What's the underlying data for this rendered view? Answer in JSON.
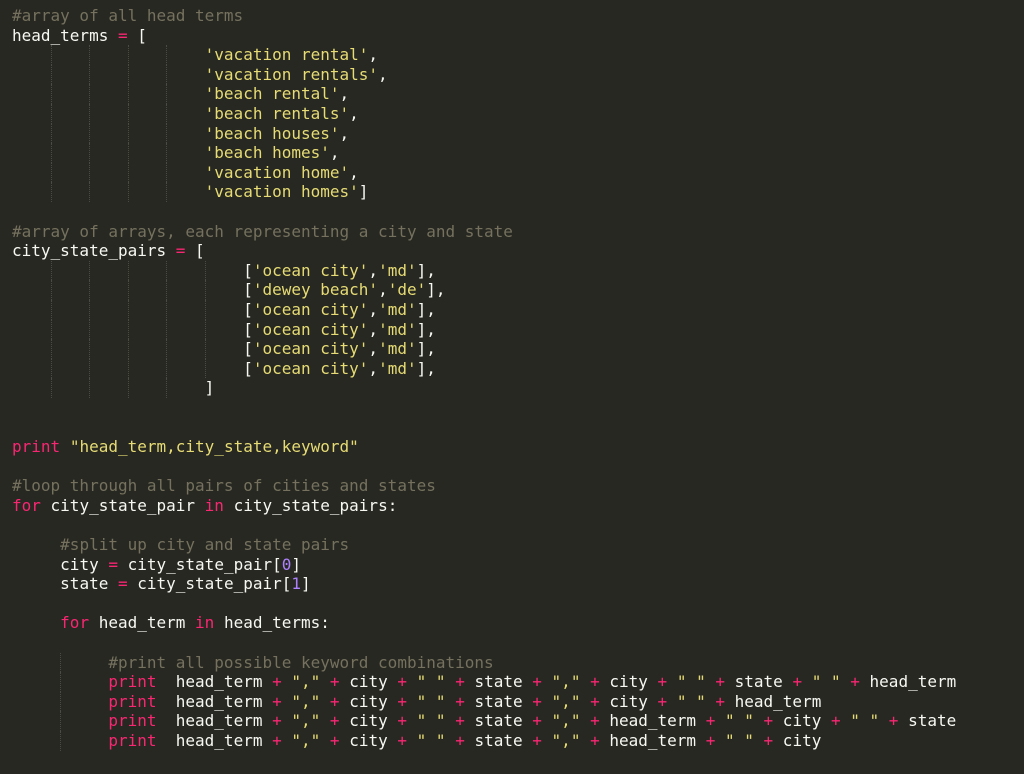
{
  "colors": {
    "background": "#272822",
    "foreground": "#f8f8f2",
    "comment": "#75715e",
    "keyword": "#f92672",
    "string": "#e6db74",
    "number": "#ae81ff"
  },
  "code_lines": [
    {
      "indent": 0,
      "guides": [],
      "tokens": [
        {
          "t": "comment",
          "v": "#array of all head terms"
        }
      ]
    },
    {
      "indent": 0,
      "guides": [],
      "tokens": [
        {
          "t": "ident",
          "v": "head_terms"
        },
        {
          "t": "punc",
          "v": " "
        },
        {
          "t": "op",
          "v": "="
        },
        {
          "t": "punc",
          "v": " ["
        }
      ]
    },
    {
      "indent": 20,
      "guides": [
        4,
        8,
        12,
        16
      ],
      "tokens": [
        {
          "t": "str",
          "v": "'vacation rental'"
        },
        {
          "t": "punc",
          "v": ","
        }
      ]
    },
    {
      "indent": 20,
      "guides": [
        4,
        8,
        12,
        16
      ],
      "tokens": [
        {
          "t": "str",
          "v": "'vacation rentals'"
        },
        {
          "t": "punc",
          "v": ","
        }
      ]
    },
    {
      "indent": 20,
      "guides": [
        4,
        8,
        12,
        16
      ],
      "tokens": [
        {
          "t": "str",
          "v": "'beach rental'"
        },
        {
          "t": "punc",
          "v": ","
        }
      ]
    },
    {
      "indent": 20,
      "guides": [
        4,
        8,
        12,
        16
      ],
      "tokens": [
        {
          "t": "str",
          "v": "'beach rentals'"
        },
        {
          "t": "punc",
          "v": ","
        }
      ]
    },
    {
      "indent": 20,
      "guides": [
        4,
        8,
        12,
        16
      ],
      "tokens": [
        {
          "t": "str",
          "v": "'beach houses'"
        },
        {
          "t": "punc",
          "v": ","
        }
      ]
    },
    {
      "indent": 20,
      "guides": [
        4,
        8,
        12,
        16
      ],
      "tokens": [
        {
          "t": "str",
          "v": "'beach homes'"
        },
        {
          "t": "punc",
          "v": ","
        }
      ]
    },
    {
      "indent": 20,
      "guides": [
        4,
        8,
        12,
        16
      ],
      "tokens": [
        {
          "t": "str",
          "v": "'vacation home'"
        },
        {
          "t": "punc",
          "v": ","
        }
      ]
    },
    {
      "indent": 20,
      "guides": [
        4,
        8,
        12,
        16
      ],
      "tokens": [
        {
          "t": "str",
          "v": "'vacation homes'"
        },
        {
          "t": "punc",
          "v": "]"
        }
      ]
    },
    {
      "indent": 0,
      "guides": [],
      "tokens": []
    },
    {
      "indent": 0,
      "guides": [],
      "tokens": [
        {
          "t": "comment",
          "v": "#array of arrays, each representing a city and state"
        }
      ]
    },
    {
      "indent": 0,
      "guides": [],
      "tokens": [
        {
          "t": "ident",
          "v": "city_state_pairs"
        },
        {
          "t": "punc",
          "v": " "
        },
        {
          "t": "op",
          "v": "="
        },
        {
          "t": "punc",
          "v": " ["
        }
      ]
    },
    {
      "indent": 24,
      "guides": [
        4,
        8,
        12,
        16,
        20
      ],
      "tokens": [
        {
          "t": "punc",
          "v": "["
        },
        {
          "t": "str",
          "v": "'ocean city'"
        },
        {
          "t": "punc",
          "v": ","
        },
        {
          "t": "str",
          "v": "'md'"
        },
        {
          "t": "punc",
          "v": "],"
        }
      ]
    },
    {
      "indent": 24,
      "guides": [
        4,
        8,
        12,
        16,
        20
      ],
      "tokens": [
        {
          "t": "punc",
          "v": "["
        },
        {
          "t": "str",
          "v": "'dewey beach'"
        },
        {
          "t": "punc",
          "v": ","
        },
        {
          "t": "str",
          "v": "'de'"
        },
        {
          "t": "punc",
          "v": "],"
        }
      ]
    },
    {
      "indent": 24,
      "guides": [
        4,
        8,
        12,
        16,
        20
      ],
      "tokens": [
        {
          "t": "punc",
          "v": "["
        },
        {
          "t": "str",
          "v": "'ocean city'"
        },
        {
          "t": "punc",
          "v": ","
        },
        {
          "t": "str",
          "v": "'md'"
        },
        {
          "t": "punc",
          "v": "],"
        }
      ]
    },
    {
      "indent": 24,
      "guides": [
        4,
        8,
        12,
        16,
        20
      ],
      "tokens": [
        {
          "t": "punc",
          "v": "["
        },
        {
          "t": "str",
          "v": "'ocean city'"
        },
        {
          "t": "punc",
          "v": ","
        },
        {
          "t": "str",
          "v": "'md'"
        },
        {
          "t": "punc",
          "v": "],"
        }
      ]
    },
    {
      "indent": 24,
      "guides": [
        4,
        8,
        12,
        16,
        20
      ],
      "tokens": [
        {
          "t": "punc",
          "v": "["
        },
        {
          "t": "str",
          "v": "'ocean city'"
        },
        {
          "t": "punc",
          "v": ","
        },
        {
          "t": "str",
          "v": "'md'"
        },
        {
          "t": "punc",
          "v": "],"
        }
      ]
    },
    {
      "indent": 24,
      "guides": [
        4,
        8,
        12,
        16,
        20
      ],
      "tokens": [
        {
          "t": "punc",
          "v": "["
        },
        {
          "t": "str",
          "v": "'ocean city'"
        },
        {
          "t": "punc",
          "v": ","
        },
        {
          "t": "str",
          "v": "'md'"
        },
        {
          "t": "punc",
          "v": "],"
        }
      ]
    },
    {
      "indent": 20,
      "guides": [
        4,
        8,
        12,
        16
      ],
      "tokens": [
        {
          "t": "punc",
          "v": "]"
        }
      ]
    },
    {
      "indent": 0,
      "guides": [],
      "tokens": []
    },
    {
      "indent": 0,
      "guides": [],
      "tokens": []
    },
    {
      "indent": 0,
      "guides": [],
      "tokens": [
        {
          "t": "keyword",
          "v": "print"
        },
        {
          "t": "punc",
          "v": " "
        },
        {
          "t": "str",
          "v": "\"head_term,city_state,keyword\""
        }
      ]
    },
    {
      "indent": 0,
      "guides": [],
      "tokens": []
    },
    {
      "indent": 0,
      "guides": [],
      "tokens": [
        {
          "t": "comment",
          "v": "#loop through all pairs of cities and states"
        }
      ]
    },
    {
      "indent": 0,
      "guides": [],
      "tokens": [
        {
          "t": "keyword",
          "v": "for"
        },
        {
          "t": "ident",
          "v": " city_state_pair "
        },
        {
          "t": "keyword",
          "v": "in"
        },
        {
          "t": "ident",
          "v": " city_state_pairs:"
        }
      ]
    },
    {
      "indent": 0,
      "guides": [],
      "tokens": []
    },
    {
      "indent": 5,
      "guides": [],
      "tokens": [
        {
          "t": "comment",
          "v": "#split up city and state pairs"
        }
      ]
    },
    {
      "indent": 5,
      "guides": [],
      "tokens": [
        {
          "t": "ident",
          "v": "city "
        },
        {
          "t": "op",
          "v": "="
        },
        {
          "t": "ident",
          "v": " city_state_pair["
        },
        {
          "t": "num",
          "v": "0"
        },
        {
          "t": "ident",
          "v": "]"
        }
      ]
    },
    {
      "indent": 5,
      "guides": [],
      "tokens": [
        {
          "t": "ident",
          "v": "state "
        },
        {
          "t": "op",
          "v": "="
        },
        {
          "t": "ident",
          "v": " city_state_pair["
        },
        {
          "t": "num",
          "v": "1"
        },
        {
          "t": "ident",
          "v": "]"
        }
      ]
    },
    {
      "indent": 0,
      "guides": [],
      "tokens": []
    },
    {
      "indent": 5,
      "guides": [],
      "tokens": [
        {
          "t": "keyword",
          "v": "for"
        },
        {
          "t": "ident",
          "v": " head_term "
        },
        {
          "t": "keyword",
          "v": "in"
        },
        {
          "t": "ident",
          "v": " head_terms:"
        }
      ]
    },
    {
      "indent": 0,
      "guides": [],
      "tokens": []
    },
    {
      "indent": 10,
      "guides": [
        5
      ],
      "tokens": [
        {
          "t": "comment",
          "v": "#print all possible keyword combinations"
        }
      ]
    },
    {
      "indent": 10,
      "guides": [
        5
      ],
      "tokens": [
        {
          "t": "keyword",
          "v": "print"
        },
        {
          "t": "ident",
          "v": "  head_term "
        },
        {
          "t": "op",
          "v": "+"
        },
        {
          "t": "ident",
          "v": " "
        },
        {
          "t": "str",
          "v": "\",\""
        },
        {
          "t": "ident",
          "v": " "
        },
        {
          "t": "op",
          "v": "+"
        },
        {
          "t": "ident",
          "v": " city "
        },
        {
          "t": "op",
          "v": "+"
        },
        {
          "t": "ident",
          "v": " "
        },
        {
          "t": "str",
          "v": "\" \""
        },
        {
          "t": "ident",
          "v": " "
        },
        {
          "t": "op",
          "v": "+"
        },
        {
          "t": "ident",
          "v": " state "
        },
        {
          "t": "op",
          "v": "+"
        },
        {
          "t": "ident",
          "v": " "
        },
        {
          "t": "str",
          "v": "\",\""
        },
        {
          "t": "ident",
          "v": " "
        },
        {
          "t": "op",
          "v": "+"
        },
        {
          "t": "ident",
          "v": " city "
        },
        {
          "t": "op",
          "v": "+"
        },
        {
          "t": "ident",
          "v": " "
        },
        {
          "t": "str",
          "v": "\" \""
        },
        {
          "t": "ident",
          "v": " "
        },
        {
          "t": "op",
          "v": "+"
        },
        {
          "t": "ident",
          "v": " state "
        },
        {
          "t": "op",
          "v": "+"
        },
        {
          "t": "ident",
          "v": " "
        },
        {
          "t": "str",
          "v": "\" \""
        },
        {
          "t": "ident",
          "v": " "
        },
        {
          "t": "op",
          "v": "+"
        },
        {
          "t": "ident",
          "v": " head_term"
        }
      ]
    },
    {
      "indent": 10,
      "guides": [
        5
      ],
      "tokens": [
        {
          "t": "keyword",
          "v": "print"
        },
        {
          "t": "ident",
          "v": "  head_term "
        },
        {
          "t": "op",
          "v": "+"
        },
        {
          "t": "ident",
          "v": " "
        },
        {
          "t": "str",
          "v": "\",\""
        },
        {
          "t": "ident",
          "v": " "
        },
        {
          "t": "op",
          "v": "+"
        },
        {
          "t": "ident",
          "v": " city "
        },
        {
          "t": "op",
          "v": "+"
        },
        {
          "t": "ident",
          "v": " "
        },
        {
          "t": "str",
          "v": "\" \""
        },
        {
          "t": "ident",
          "v": " "
        },
        {
          "t": "op",
          "v": "+"
        },
        {
          "t": "ident",
          "v": " state "
        },
        {
          "t": "op",
          "v": "+"
        },
        {
          "t": "ident",
          "v": " "
        },
        {
          "t": "str",
          "v": "\",\""
        },
        {
          "t": "ident",
          "v": " "
        },
        {
          "t": "op",
          "v": "+"
        },
        {
          "t": "ident",
          "v": " city "
        },
        {
          "t": "op",
          "v": "+"
        },
        {
          "t": "ident",
          "v": " "
        },
        {
          "t": "str",
          "v": "\" \""
        },
        {
          "t": "ident",
          "v": " "
        },
        {
          "t": "op",
          "v": "+"
        },
        {
          "t": "ident",
          "v": " head_term"
        }
      ]
    },
    {
      "indent": 10,
      "guides": [
        5
      ],
      "tokens": [
        {
          "t": "keyword",
          "v": "print"
        },
        {
          "t": "ident",
          "v": "  head_term "
        },
        {
          "t": "op",
          "v": "+"
        },
        {
          "t": "ident",
          "v": " "
        },
        {
          "t": "str",
          "v": "\",\""
        },
        {
          "t": "ident",
          "v": " "
        },
        {
          "t": "op",
          "v": "+"
        },
        {
          "t": "ident",
          "v": " city "
        },
        {
          "t": "op",
          "v": "+"
        },
        {
          "t": "ident",
          "v": " "
        },
        {
          "t": "str",
          "v": "\" \""
        },
        {
          "t": "ident",
          "v": " "
        },
        {
          "t": "op",
          "v": "+"
        },
        {
          "t": "ident",
          "v": " state "
        },
        {
          "t": "op",
          "v": "+"
        },
        {
          "t": "ident",
          "v": " "
        },
        {
          "t": "str",
          "v": "\",\""
        },
        {
          "t": "ident",
          "v": " "
        },
        {
          "t": "op",
          "v": "+"
        },
        {
          "t": "ident",
          "v": " head_term "
        },
        {
          "t": "op",
          "v": "+"
        },
        {
          "t": "ident",
          "v": " "
        },
        {
          "t": "str",
          "v": "\" \""
        },
        {
          "t": "ident",
          "v": " "
        },
        {
          "t": "op",
          "v": "+"
        },
        {
          "t": "ident",
          "v": " city "
        },
        {
          "t": "op",
          "v": "+"
        },
        {
          "t": "ident",
          "v": " "
        },
        {
          "t": "str",
          "v": "\" \""
        },
        {
          "t": "ident",
          "v": " "
        },
        {
          "t": "op",
          "v": "+"
        },
        {
          "t": "ident",
          "v": " state"
        }
      ]
    },
    {
      "indent": 10,
      "guides": [
        5
      ],
      "tokens": [
        {
          "t": "keyword",
          "v": "print"
        },
        {
          "t": "ident",
          "v": "  head_term "
        },
        {
          "t": "op",
          "v": "+"
        },
        {
          "t": "ident",
          "v": " "
        },
        {
          "t": "str",
          "v": "\",\""
        },
        {
          "t": "ident",
          "v": " "
        },
        {
          "t": "op",
          "v": "+"
        },
        {
          "t": "ident",
          "v": " city "
        },
        {
          "t": "op",
          "v": "+"
        },
        {
          "t": "ident",
          "v": " "
        },
        {
          "t": "str",
          "v": "\" \""
        },
        {
          "t": "ident",
          "v": " "
        },
        {
          "t": "op",
          "v": "+"
        },
        {
          "t": "ident",
          "v": " state "
        },
        {
          "t": "op",
          "v": "+"
        },
        {
          "t": "ident",
          "v": " "
        },
        {
          "t": "str",
          "v": "\",\""
        },
        {
          "t": "ident",
          "v": " "
        },
        {
          "t": "op",
          "v": "+"
        },
        {
          "t": "ident",
          "v": " head_term "
        },
        {
          "t": "op",
          "v": "+"
        },
        {
          "t": "ident",
          "v": " "
        },
        {
          "t": "str",
          "v": "\" \""
        },
        {
          "t": "ident",
          "v": " "
        },
        {
          "t": "op",
          "v": "+"
        },
        {
          "t": "ident",
          "v": " city"
        }
      ]
    }
  ]
}
